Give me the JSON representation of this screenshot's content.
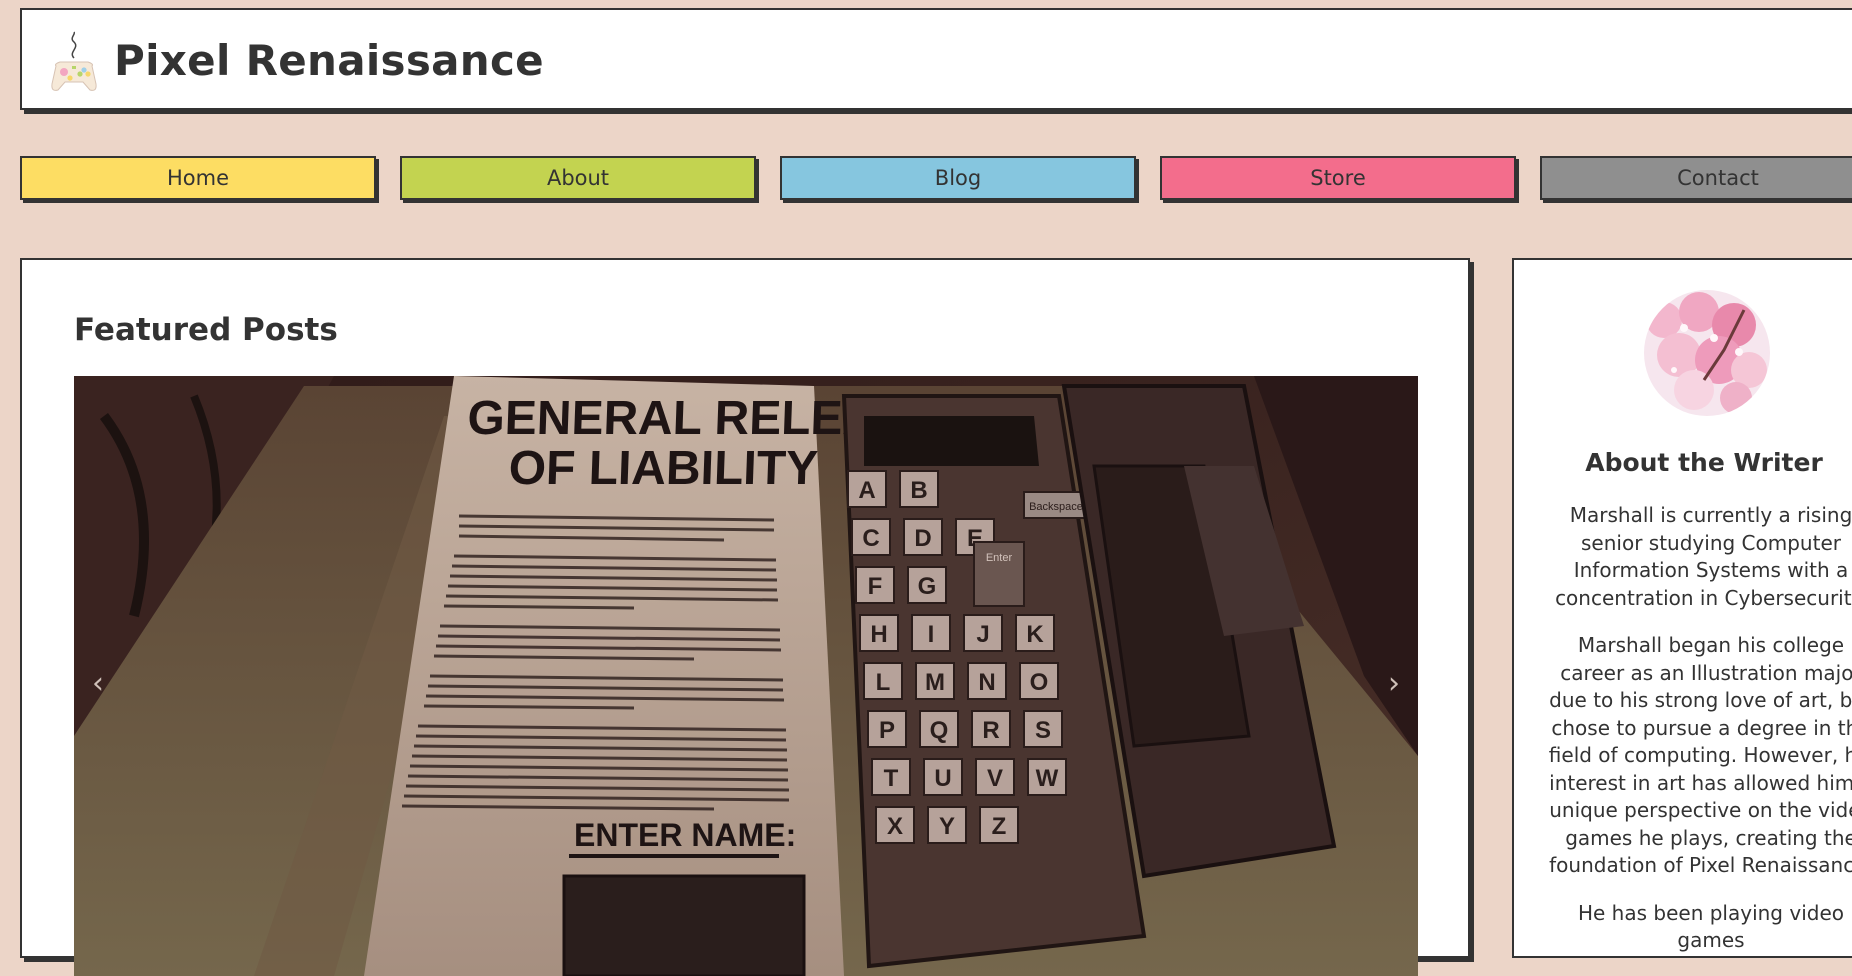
{
  "site": {
    "title": "Pixel Renaissance",
    "logo_icon": "game-controller-icon"
  },
  "nav": {
    "items": [
      {
        "label": "Home",
        "color": "#fddd63"
      },
      {
        "label": "About",
        "color": "#c3d350"
      },
      {
        "label": "Blog",
        "color": "#86c6df"
      },
      {
        "label": "Store",
        "color": "#f36d8c"
      },
      {
        "label": "Contact",
        "color": "#8f8f8f"
      }
    ]
  },
  "featured": {
    "title": "Featured Posts",
    "slide_document_title": [
      "GENERAL RELEASE",
      "OF LIABILITY"
    ],
    "slide_enter_name": "ENTER NAME:",
    "slide_backspace": "Backspace",
    "slide_enter": "Enter",
    "slide_keys": [
      [
        "A",
        "B"
      ],
      [
        "C",
        "D",
        "E"
      ],
      [
        "F",
        "G"
      ],
      [
        "H",
        "I",
        "J",
        "K"
      ],
      [
        "L",
        "M",
        "N",
        "O"
      ],
      [
        "P",
        "Q",
        "R",
        "S"
      ],
      [
        "T",
        "U",
        "V",
        "W"
      ],
      [
        "X",
        "Y",
        "Z"
      ]
    ],
    "prev_arrow": "‹",
    "next_arrow": "›"
  },
  "about": {
    "heading": "About the Writer",
    "paragraphs": [
      "Marshall is currently a rising senior studying Computer Information Systems with a concentration in Cybersecurity.",
      "Marshall began his college career as an Illustration major due to his strong love of art, but chose to pursue a degree in the field of computing. However, his interest in art has allowed him a unique perspective on the video games he plays, creating the foundation of Pixel Renaissance.",
      "He has been playing video games"
    ]
  }
}
